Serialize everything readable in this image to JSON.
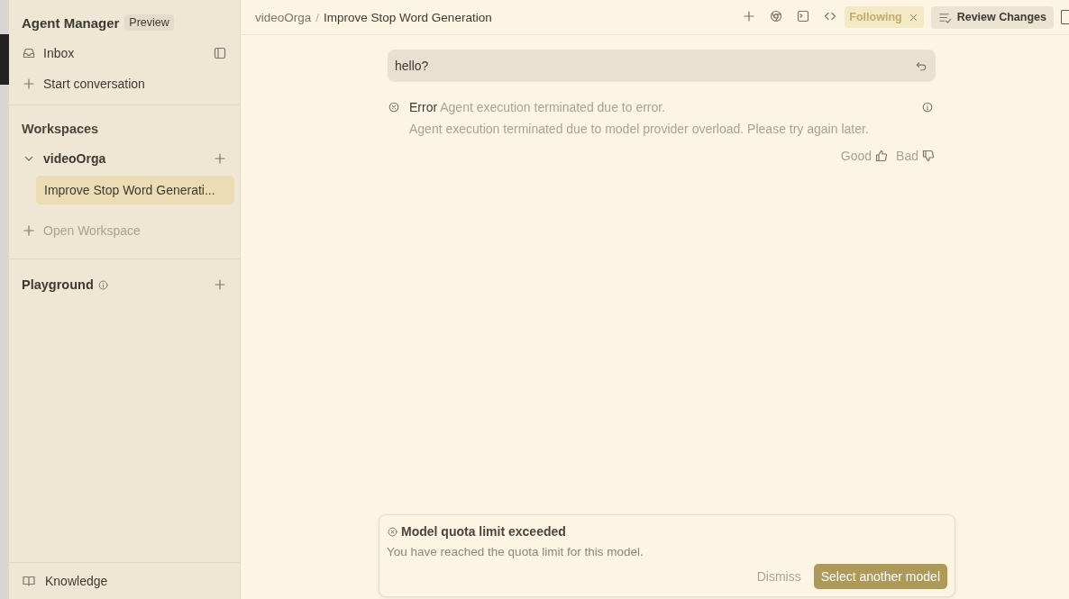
{
  "sidebar": {
    "title": "Agent Manager",
    "badge": "Preview",
    "items": [
      {
        "kind": "inbox",
        "label": "Inbox"
      },
      {
        "kind": "add",
        "label": "Start conversation"
      }
    ],
    "workspaces": {
      "heading": "Workspaces",
      "groups": [
        {
          "name": "videoOrga",
          "expanded": true,
          "children": [
            {
              "label": "Improve Stop Word Generati...",
              "selected": true
            }
          ]
        }
      ],
      "open": "Open Workspace"
    },
    "playground": {
      "heading": "Playground"
    },
    "footer": {
      "label": "Knowledge"
    }
  },
  "header": {
    "breadcrumb": [
      "videoOrga",
      "Improve Stop Word Generation"
    ],
    "separator": "/",
    "following": "Following",
    "review": "Review Changes"
  },
  "chat": {
    "message": "hello?",
    "error": {
      "label": "Error",
      "summary": "Agent execution terminated due to error.",
      "detail": "Agent execution terminated due to model provider overload. Please try again later."
    },
    "feedback": {
      "good": "Good",
      "bad": "Bad"
    }
  },
  "toast": {
    "title": "Model quota limit exceeded",
    "body": "You have reached the quota limit for this model.",
    "dismiss": "Dismiss",
    "action": "Select another model"
  }
}
